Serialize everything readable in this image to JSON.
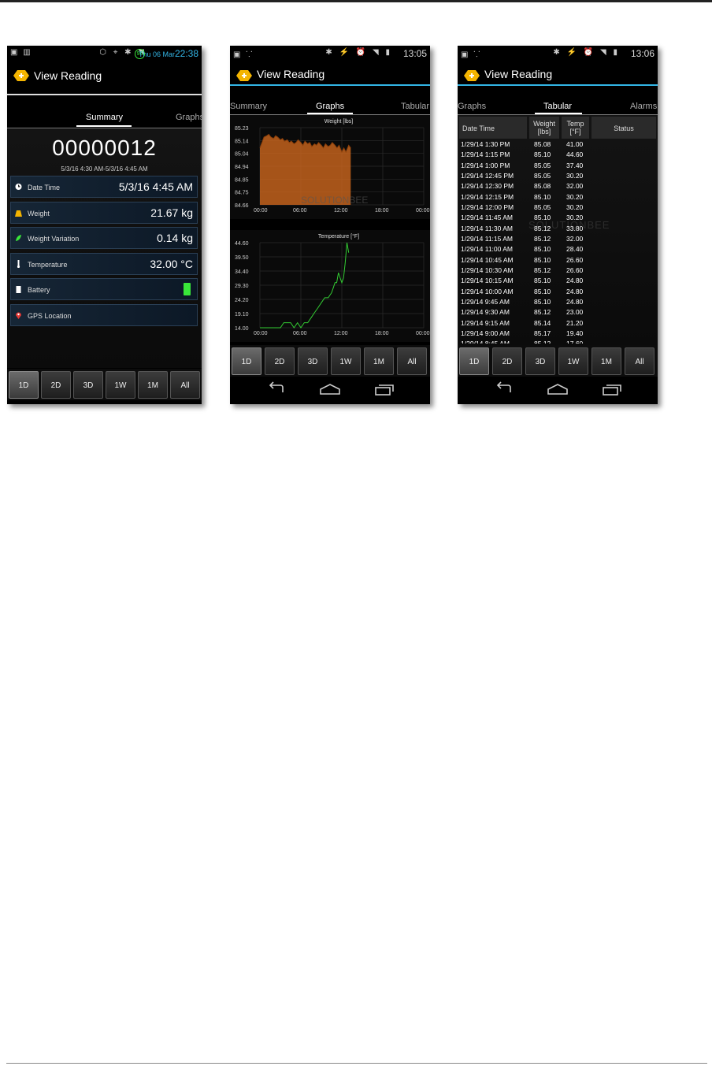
{
  "app_title": "View Reading",
  "tabs": {
    "summary": "Summary",
    "graphs": "Graphs",
    "tabular": "Tabular",
    "alarms": "Alarms"
  },
  "period_buttons": [
    "1D",
    "2D",
    "3D",
    "1W",
    "1M",
    "All"
  ],
  "selected_period": "1D",
  "watermark_text": "SOLUTIONBEE",
  "screen1": {
    "status_time": "22:38",
    "status_date": "Thu 06 Mar",
    "battery_badge": "96",
    "device_id": "00000012",
    "date_range": "5/3/16 4:30 AM-5/3/16 4:45 AM",
    "rows": [
      {
        "label": "Date Time",
        "value": "5/3/16 4:45 AM",
        "icon": "clock-icon"
      },
      {
        "label": "Weight",
        "value": "21.67 kg",
        "icon": "weight-icon"
      },
      {
        "label": "Weight Variation",
        "value": "0.14 kg",
        "icon": "leaf-icon"
      },
      {
        "label": "Temperature",
        "value": "32.00 °C",
        "icon": "thermometer-icon"
      },
      {
        "label": "Battery",
        "value": "",
        "icon": "battery-icon"
      },
      {
        "label": "GPS Location",
        "value": "",
        "icon": "location-pin-icon"
      }
    ],
    "battery_color": "#39e639"
  },
  "screen2": {
    "status_time": "13:05",
    "chart_data": [
      {
        "type": "area",
        "title": "Weight [lbs]",
        "xlabel": "",
        "ylabel": "",
        "x_ticks": [
          "00:00",
          "06:00",
          "12:00",
          "18:00",
          "00:00"
        ],
        "y_ticks": [
          "85.23",
          "85.14",
          "85.04",
          "84.94",
          "84.85",
          "84.75",
          "84.66"
        ],
        "ylim": [
          84.66,
          85.23
        ],
        "xlim_hours": [
          0,
          24
        ],
        "color": "#d2691e",
        "x": [
          0,
          0.3,
          0.6,
          1.0,
          1.3,
          1.6,
          2.0,
          2.3,
          2.6,
          3.0,
          3.3,
          3.6,
          4.0,
          4.3,
          4.6,
          5.0,
          5.3,
          5.6,
          6.0,
          6.3,
          6.6,
          7.0,
          7.3,
          7.6,
          8.0,
          8.3,
          8.6,
          9.0,
          9.3,
          9.6,
          10.0,
          10.3,
          10.6,
          11.0,
          11.3,
          11.6,
          12.0,
          12.3,
          12.6,
          13.0,
          13.3
        ],
        "values": [
          85.08,
          85.12,
          85.16,
          85.17,
          85.18,
          85.16,
          85.15,
          85.17,
          85.16,
          85.14,
          85.15,
          85.13,
          85.14,
          85.12,
          85.13,
          85.11,
          85.12,
          85.14,
          85.12,
          85.1,
          85.13,
          85.11,
          85.12,
          85.09,
          85.11,
          85.1,
          85.12,
          85.1,
          85.08,
          85.11,
          85.09,
          85.1,
          85.12,
          85.1,
          85.08,
          85.1,
          85.05,
          85.08,
          85.05,
          85.1,
          85.08
        ]
      },
      {
        "type": "line",
        "title": "Temperature [°F]",
        "xlabel": "",
        "ylabel": "",
        "x_ticks": [
          "00:00",
          "06:00",
          "12:00",
          "18:00",
          "00:00"
        ],
        "y_ticks": [
          "44.60",
          "39.50",
          "34.40",
          "29.30",
          "24.20",
          "19.10",
          "14.00"
        ],
        "ylim": [
          14.0,
          44.6
        ],
        "xlim_hours": [
          0,
          24
        ],
        "color": "#33cc33",
        "x": [
          0,
          1.0,
          2.0,
          3.0,
          3.5,
          4.0,
          4.5,
          5.0,
          5.5,
          6.0,
          6.5,
          7.0,
          7.5,
          8.0,
          8.5,
          9.0,
          9.5,
          10.0,
          10.5,
          10.75,
          11.0,
          11.25,
          11.5,
          11.75,
          12.0,
          12.25,
          12.5,
          12.75,
          13.0
        ],
        "values": [
          14.0,
          14.0,
          14.0,
          14.0,
          15.8,
          15.8,
          15.8,
          14.0,
          15.8,
          14.0,
          15.8,
          15.8,
          17.6,
          19.4,
          21.2,
          23.0,
          24.8,
          24.8,
          26.6,
          28.4,
          30.2,
          30.2,
          33.8,
          32.0,
          30.2,
          32.0,
          37.4,
          44.6,
          41.0
        ]
      }
    ]
  },
  "screen3": {
    "status_time": "13:06",
    "headers": {
      "datetime": "Date Time",
      "weight": "Weight [lbs]",
      "weight_line1": "Weight",
      "weight_line2": "[lbs]",
      "temp_line1": "Temp",
      "temp_line2": "[°F]",
      "status": "Status"
    },
    "rows": [
      [
        "1/29/14 1:30 PM",
        "85.08",
        "41.00"
      ],
      [
        "1/29/14 1:15 PM",
        "85.10",
        "44.60"
      ],
      [
        "1/29/14 1:00 PM",
        "85.05",
        "37.40"
      ],
      [
        "1/29/14 12:45 PM",
        "85.05",
        "30.20"
      ],
      [
        "1/29/14 12:30 PM",
        "85.08",
        "32.00"
      ],
      [
        "1/29/14 12:15 PM",
        "85.10",
        "30.20"
      ],
      [
        "1/29/14 12:00 PM",
        "85.05",
        "30.20"
      ],
      [
        "1/29/14 11:45 AM",
        "85.10",
        "30.20"
      ],
      [
        "1/29/14 11:30 AM",
        "85.12",
        "33.80"
      ],
      [
        "1/29/14 11:15 AM",
        "85.12",
        "32.00"
      ],
      [
        "1/29/14 11:00 AM",
        "85.10",
        "28.40"
      ],
      [
        "1/29/14 10:45 AM",
        "85.10",
        "26.60"
      ],
      [
        "1/29/14 10:30 AM",
        "85.12",
        "26.60"
      ],
      [
        "1/29/14 10:15 AM",
        "85.10",
        "24.80"
      ],
      [
        "1/29/14 10:00 AM",
        "85.10",
        "24.80"
      ],
      [
        "1/29/14 9:45 AM",
        "85.10",
        "24.80"
      ],
      [
        "1/29/14 9:30 AM",
        "85.12",
        "23.00"
      ],
      [
        "1/29/14 9:15 AM",
        "85.14",
        "21.20"
      ],
      [
        "1/29/14 9:00 AM",
        "85.17",
        "19.40"
      ],
      [
        "1/29/14 8:45 AM",
        "85.12",
        "17.60"
      ]
    ]
  }
}
